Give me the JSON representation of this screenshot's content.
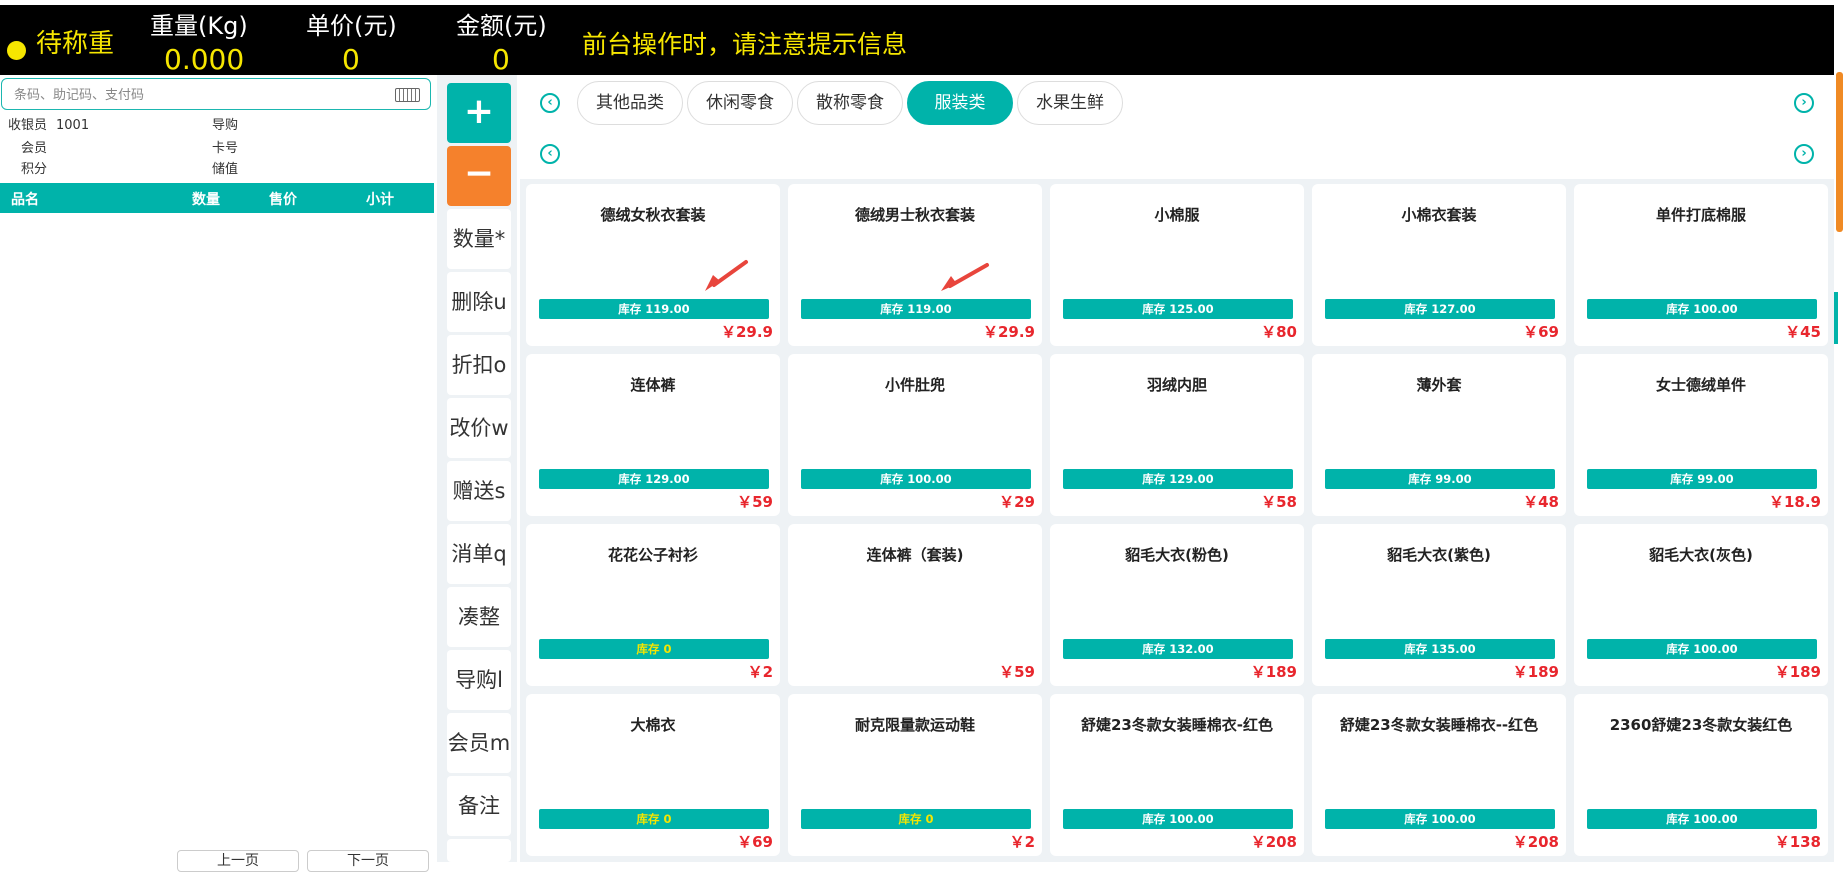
{
  "header": {
    "status": "待称重",
    "weight": {
      "label": "重量(Kg)",
      "value": "0.000"
    },
    "unit_price": {
      "label": "单价(元)",
      "value": "0"
    },
    "amount": {
      "label": "金额(元)",
      "value": "0"
    },
    "notice": "前台操作时，请注意提示信息"
  },
  "search": {
    "placeholder": "条码、助记码、支付码"
  },
  "info": {
    "cashier_label": "收银员",
    "cashier_value": "1001",
    "guide_label": "导购",
    "member_label": "会员",
    "card_label": "卡号",
    "points_label": "积分",
    "balance_label": "储值"
  },
  "cart": {
    "columns": [
      "品名",
      "数量",
      "售价",
      "小计"
    ]
  },
  "pager": {
    "prev": "上一页",
    "next": "下一页"
  },
  "ops": {
    "plus": "+",
    "minus": "−",
    "buttons": [
      "数量*",
      "删除u",
      "折扣o",
      "改价w",
      "赠送s",
      "消单q",
      "凑整",
      "导购l",
      "会员m",
      "备注"
    ]
  },
  "categories": [
    {
      "label": "其他品类",
      "active": false
    },
    {
      "label": "休闲零食",
      "active": false
    },
    {
      "label": "散称零食",
      "active": false
    },
    {
      "label": "服装类",
      "active": true
    },
    {
      "label": "水果生鲜",
      "active": false
    }
  ],
  "products": [
    {
      "name": "德绒女秋衣套装",
      "stock": "库存 119.00",
      "price": "￥29.9"
    },
    {
      "name": "德绒男士秋衣套装",
      "stock": "库存 119.00",
      "price": "￥29.9"
    },
    {
      "name": "小棉服",
      "stock": "库存 125.00",
      "price": "￥80"
    },
    {
      "name": "小棉衣套装",
      "stock": "库存 127.00",
      "price": "￥69"
    },
    {
      "name": "单件打底棉服",
      "stock": "库存 100.00",
      "price": "￥45"
    },
    {
      "name": "连体裤",
      "stock": "库存 129.00",
      "price": "￥59"
    },
    {
      "name": "小件肚兜",
      "stock": "库存 100.00",
      "price": "￥29"
    },
    {
      "name": "羽绒内胆",
      "stock": "库存 129.00",
      "price": "￥58"
    },
    {
      "name": "薄外套",
      "stock": "库存 99.00",
      "price": "￥48"
    },
    {
      "name": "女士德绒单件",
      "stock": "库存 99.00",
      "price": "￥18.9"
    },
    {
      "name": "花花公子衬衫",
      "stock": "库存 0",
      "price": "￥2"
    },
    {
      "name": "连体裤（套装)",
      "stock": "",
      "price": "￥59"
    },
    {
      "name": "貂毛大衣(粉色)",
      "stock": "库存 132.00",
      "price": "￥189"
    },
    {
      "name": "貂毛大衣(紫色)",
      "stock": "库存 135.00",
      "price": "￥189"
    },
    {
      "name": "貂毛大衣(灰色)",
      "stock": "库存 100.00",
      "price": "￥189"
    },
    {
      "name": "大棉衣",
      "stock": "库存 0",
      "price": "￥69"
    },
    {
      "name": "耐克限量款运动鞋",
      "stock": "库存 0",
      "price": "￥2"
    },
    {
      "name": "舒婕23冬款女装睡棉衣-红色",
      "stock": "库存 100.00",
      "price": "￥208"
    },
    {
      "name": "舒婕23冬款女装睡棉衣--红色",
      "stock": "库存 100.00",
      "price": "￥208"
    },
    {
      "name": "2360舒婕23冬款女装红色",
      "stock": "库存 100.00",
      "price": "￥138"
    }
  ],
  "colors": {
    "accent": "#00b3aa",
    "warn": "#f5812c",
    "price": "#e8262d",
    "header_text": "#f6e600",
    "arrow": "#e8453c"
  },
  "icons": {
    "nav_prev": "chevron-left-circle-icon",
    "nav_next": "chevron-right-circle-icon",
    "keyboard": "keyboard-icon"
  }
}
